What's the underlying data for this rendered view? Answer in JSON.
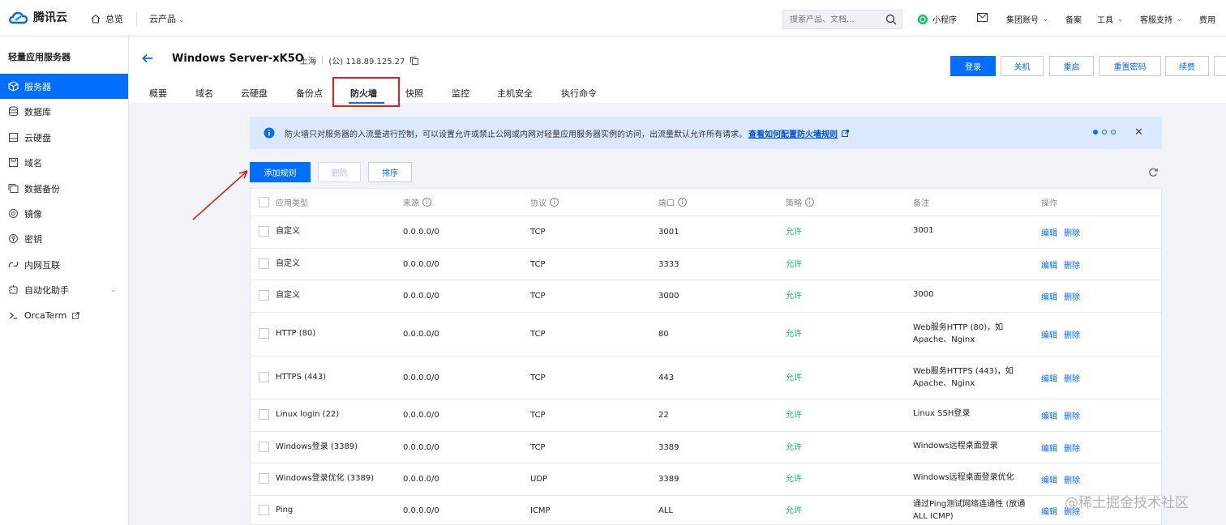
{
  "topbar": {
    "brand": "腾讯云",
    "overview": "总览",
    "products": "云产品",
    "search_placeholder": "搜索产品、文档...",
    "mini_program": "小程序",
    "group_account": "集团账号",
    "beian": "备案",
    "tools": "工具",
    "support": "客服支持",
    "billing": "费用"
  },
  "sidebar": {
    "title": "轻量应用服务器",
    "items": [
      {
        "label": "服务器",
        "icon": "cube-icon"
      },
      {
        "label": "数据库",
        "icon": "database-icon"
      },
      {
        "label": "云硬盘",
        "icon": "disk-icon"
      },
      {
        "label": "域名",
        "icon": "domain-icon"
      },
      {
        "label": "数据备份",
        "icon": "backup-icon"
      },
      {
        "label": "镜像",
        "icon": "image-icon"
      },
      {
        "label": "密钥",
        "icon": "key-icon"
      },
      {
        "label": "内网互联",
        "icon": "link-icon"
      },
      {
        "label": "自动化助手",
        "icon": "assistant-icon"
      },
      {
        "label": "OrcaTerm",
        "icon": "terminal-icon"
      }
    ]
  },
  "server": {
    "name": "Windows Server-xK5O",
    "region": "上海",
    "ip": "(公) 118.89.125.27"
  },
  "actions": {
    "login": "登录",
    "shutdown": "关机",
    "restart": "重启",
    "reset_password": "重置密码",
    "renew": "续费"
  },
  "tabs": [
    "概要",
    "域名",
    "云硬盘",
    "备份点",
    "防火墙",
    "快照",
    "监控",
    "主机安全",
    "执行命令"
  ],
  "notice": {
    "text": "防火墙只对服务器的入流量进行控制，可以设置允许或禁止公网或内网对轻量应用服务器实例的访问，出流量默认允许所有请求。",
    "link": "查看如何配置防火墙规则"
  },
  "toolbar": {
    "add": "添加规则",
    "delete": "删除",
    "sort": "排序"
  },
  "table": {
    "headers": [
      "应用类型",
      "来源",
      "协议",
      "端口",
      "策略",
      "备注",
      "操作"
    ],
    "rows": [
      {
        "type": "自定义",
        "source": "0.0.0.0/0",
        "protocol": "TCP",
        "port": "3001",
        "policy": "允许",
        "note1": "3001",
        "note2": ""
      },
      {
        "type": "自定义",
        "source": "0.0.0.0/0",
        "protocol": "TCP",
        "port": "3333",
        "policy": "允许",
        "note1": "",
        "note2": ""
      },
      {
        "type": "自定义",
        "source": "0.0.0.0/0",
        "protocol": "TCP",
        "port": "3000",
        "policy": "允许",
        "note1": "3000",
        "note2": ""
      },
      {
        "type": "HTTP (80)",
        "source": "0.0.0.0/0",
        "protocol": "TCP",
        "port": "80",
        "policy": "允许",
        "note1": "Web服务HTTP (80)，如",
        "note2": "Apache、Nginx"
      },
      {
        "type": "HTTPS (443)",
        "source": "0.0.0.0/0",
        "protocol": "TCP",
        "port": "443",
        "policy": "允许",
        "note1": "Web服务HTTPS (443)，如",
        "note2": "Apache、Nginx"
      },
      {
        "type": "Linux login (22)",
        "source": "0.0.0.0/0",
        "protocol": "TCP",
        "port": "22",
        "policy": "允许",
        "note1": "Linux SSH登录",
        "note2": ""
      },
      {
        "type": "Windows登录 (3389)",
        "source": "0.0.0.0/0",
        "protocol": "TCP",
        "port": "3389",
        "policy": "允许",
        "note1": "Windows远程桌面登录",
        "note2": ""
      },
      {
        "type": "Windows登录优化 (3389)",
        "source": "0.0.0.0/0",
        "protocol": "UDP",
        "port": "3389",
        "policy": "允许",
        "note1": "Windows远程桌面登录优化",
        "note2": ""
      },
      {
        "type": "Ping",
        "source": "0.0.0.0/0",
        "protocol": "ICMP",
        "port": "ALL",
        "policy": "允许",
        "note1": "通过Ping测试网络连通性 (放通",
        "note2": "ALL ICMP)"
      }
    ],
    "edit": "编辑",
    "delete": "删除"
  },
  "watermark": "@稀土掘金技术社区"
}
